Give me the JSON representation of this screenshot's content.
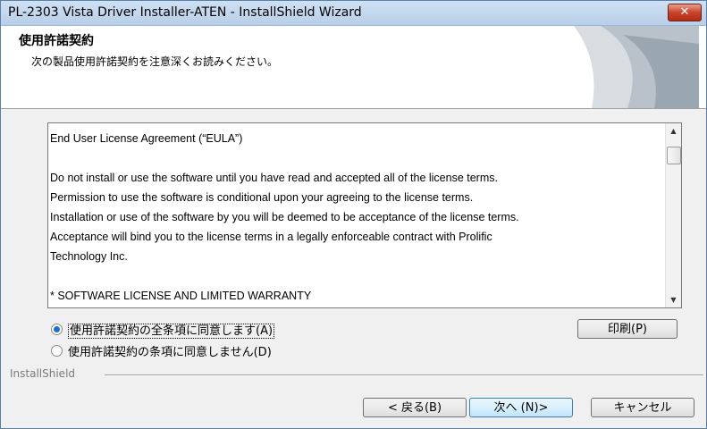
{
  "window": {
    "title": "PL-2303 Vista Driver Installer-ATEN - InstallShield Wizard",
    "close_label": "✕"
  },
  "header": {
    "title": "使用許諾契約",
    "subtitle": "次の製品使用許諾契約を注意深くお読みください。"
  },
  "eula": {
    "text": "End User License Agreement (“EULA”)\n\nDo not install or use the software until you have read and accepted all of the license terms.\nPermission to use the software is conditional upon your agreeing to the license terms.\nInstallation or use of the software by you will be deemed to be acceptance of the license terms.\nAcceptance will bind you to the license terms in a legally enforceable contract with Prolific\nTechnology Inc.\n\n* SOFTWARE LICENSE AND LIMITED WARRANTY"
  },
  "options": {
    "accept_label": "使用許諾契約の全条項に同意します(A)",
    "decline_label": "使用許諾契約の条項に同意しません(D)",
    "selected": "accept"
  },
  "buttons": {
    "print": "印刷(P)",
    "back": "< 戻る(B)",
    "next": "次へ (N)>",
    "cancel": "キャンセル"
  },
  "brand": "InstallShield",
  "colors": {
    "accent": "#1f6fd1",
    "close": "#c8432b"
  }
}
